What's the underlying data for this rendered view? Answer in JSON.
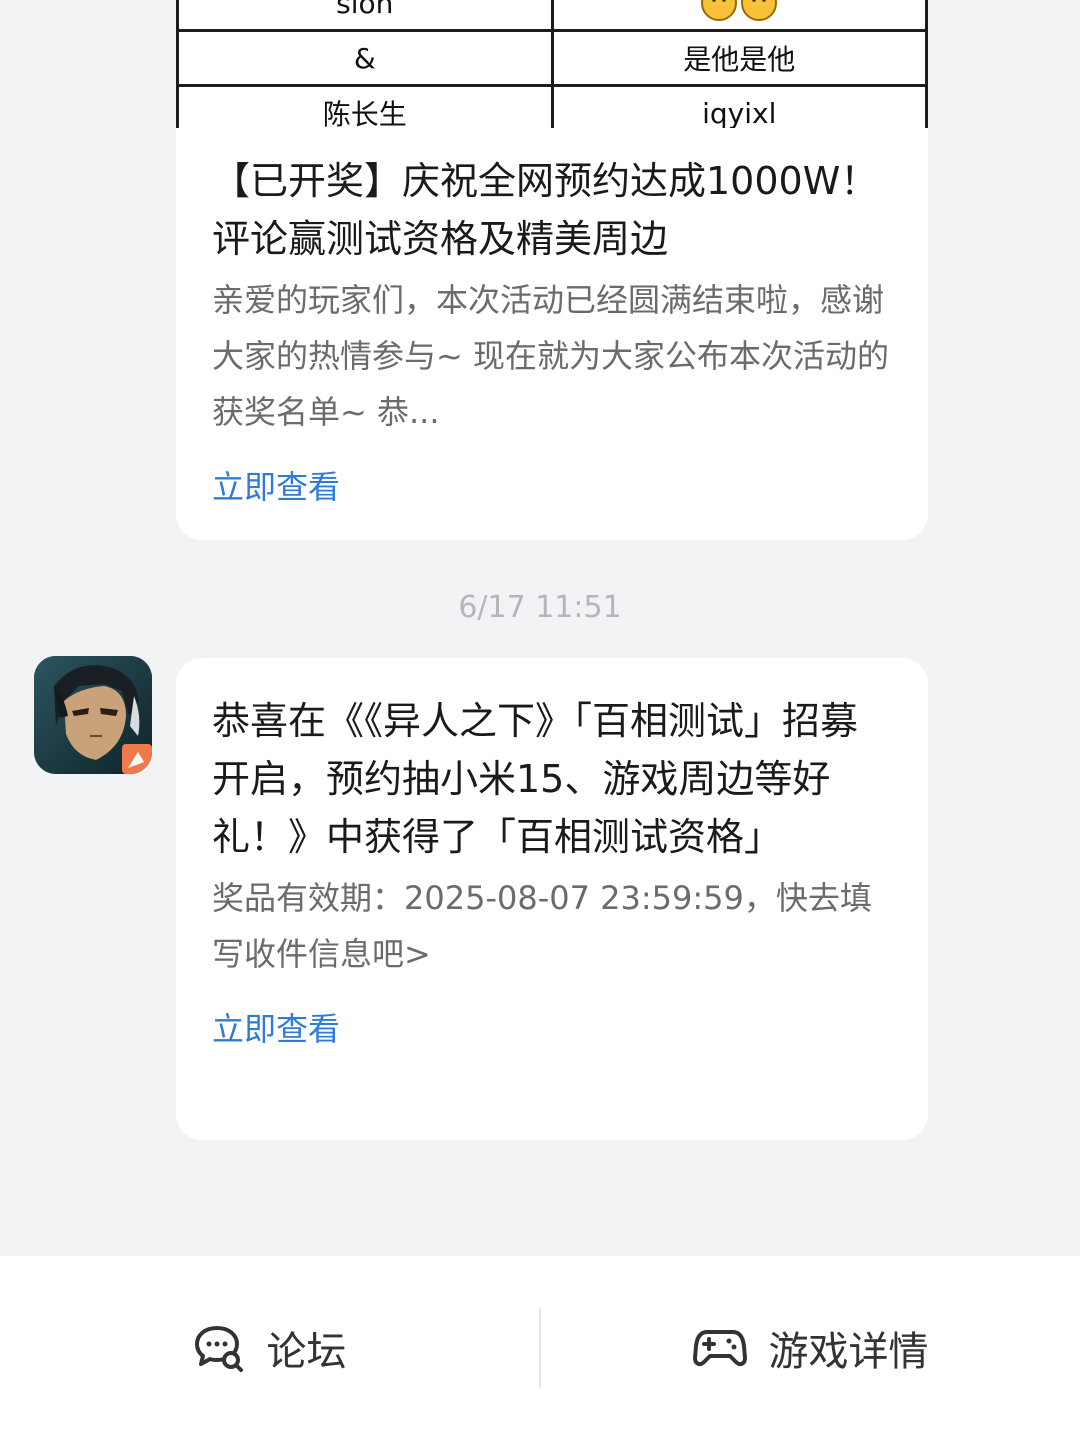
{
  "winner_table": {
    "rows": [
      [
        "sion",
        ""
      ],
      [
        "&",
        "是他是他"
      ],
      [
        "陈长生",
        "iqyixl"
      ]
    ]
  },
  "messages": [
    {
      "title": "【已开奖】庆祝全网预约达成1000W！评论赢测试资格及精美周边",
      "description": "亲爱的玩家们，本次活动已经圆满结束啦，感谢大家的热情参与~ 现在就为大家公布本次活动的获奖名单~ 恭...",
      "link_label": "立即查看"
    },
    {
      "timestamp": "6/17  11:51",
      "title": "恭喜在《《异人之下》「百相测试」招募开启，预约抽小米15、游戏周边等好礼！》中获得了「百相测试资格」",
      "description": "奖品有效期：2025-08-07 23:59:59，快去填写收件信息吧>",
      "link_label": "立即查看"
    }
  ],
  "bottom_bar": {
    "forum_label": "论坛",
    "forum_icon": "forum-chat-icon",
    "game_label": "游戏详情",
    "game_icon": "gamepad-icon"
  },
  "colors": {
    "background": "#f2f3f5",
    "card": "#ffffff",
    "link": "#2f7bd8",
    "timestamp": "#b3b6bc"
  }
}
